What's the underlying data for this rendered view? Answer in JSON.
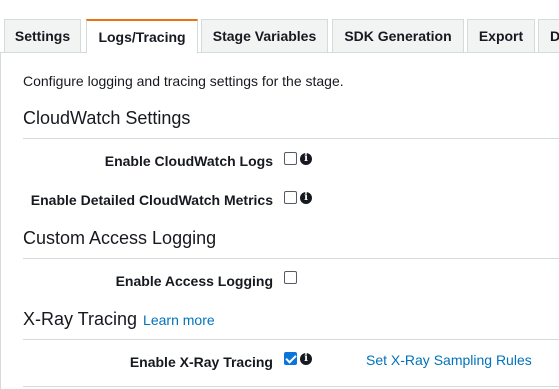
{
  "tabs": [
    {
      "label": "Settings",
      "active": false
    },
    {
      "label": "Logs/Tracing",
      "active": true
    },
    {
      "label": "Stage Variables",
      "active": false
    },
    {
      "label": "SDK Generation",
      "active": false
    },
    {
      "label": "Export",
      "active": false
    },
    {
      "label": "D",
      "active": false
    }
  ],
  "intro_text": "Configure logging and tracing settings for the stage.",
  "cloudwatch": {
    "title": "CloudWatch Settings",
    "enable_logs_label": "Enable CloudWatch Logs",
    "enable_logs_checked": false,
    "enable_metrics_label": "Enable Detailed CloudWatch Metrics",
    "enable_metrics_checked": false
  },
  "access_logging": {
    "title": "Custom Access Logging",
    "enable_label": "Enable Access Logging",
    "enable_checked": false
  },
  "xray": {
    "title": "X-Ray Tracing",
    "learn_more": "Learn more",
    "enable_label": "Enable X-Ray Tracing",
    "enable_checked": true,
    "sampling_rules_link": "Set X-Ray Sampling Rules"
  },
  "icons": {
    "info": "info-icon"
  },
  "colors": {
    "active_tab_accent": "#ec7211",
    "link": "#0073bb",
    "checkbox_checked": "#0a74da"
  }
}
